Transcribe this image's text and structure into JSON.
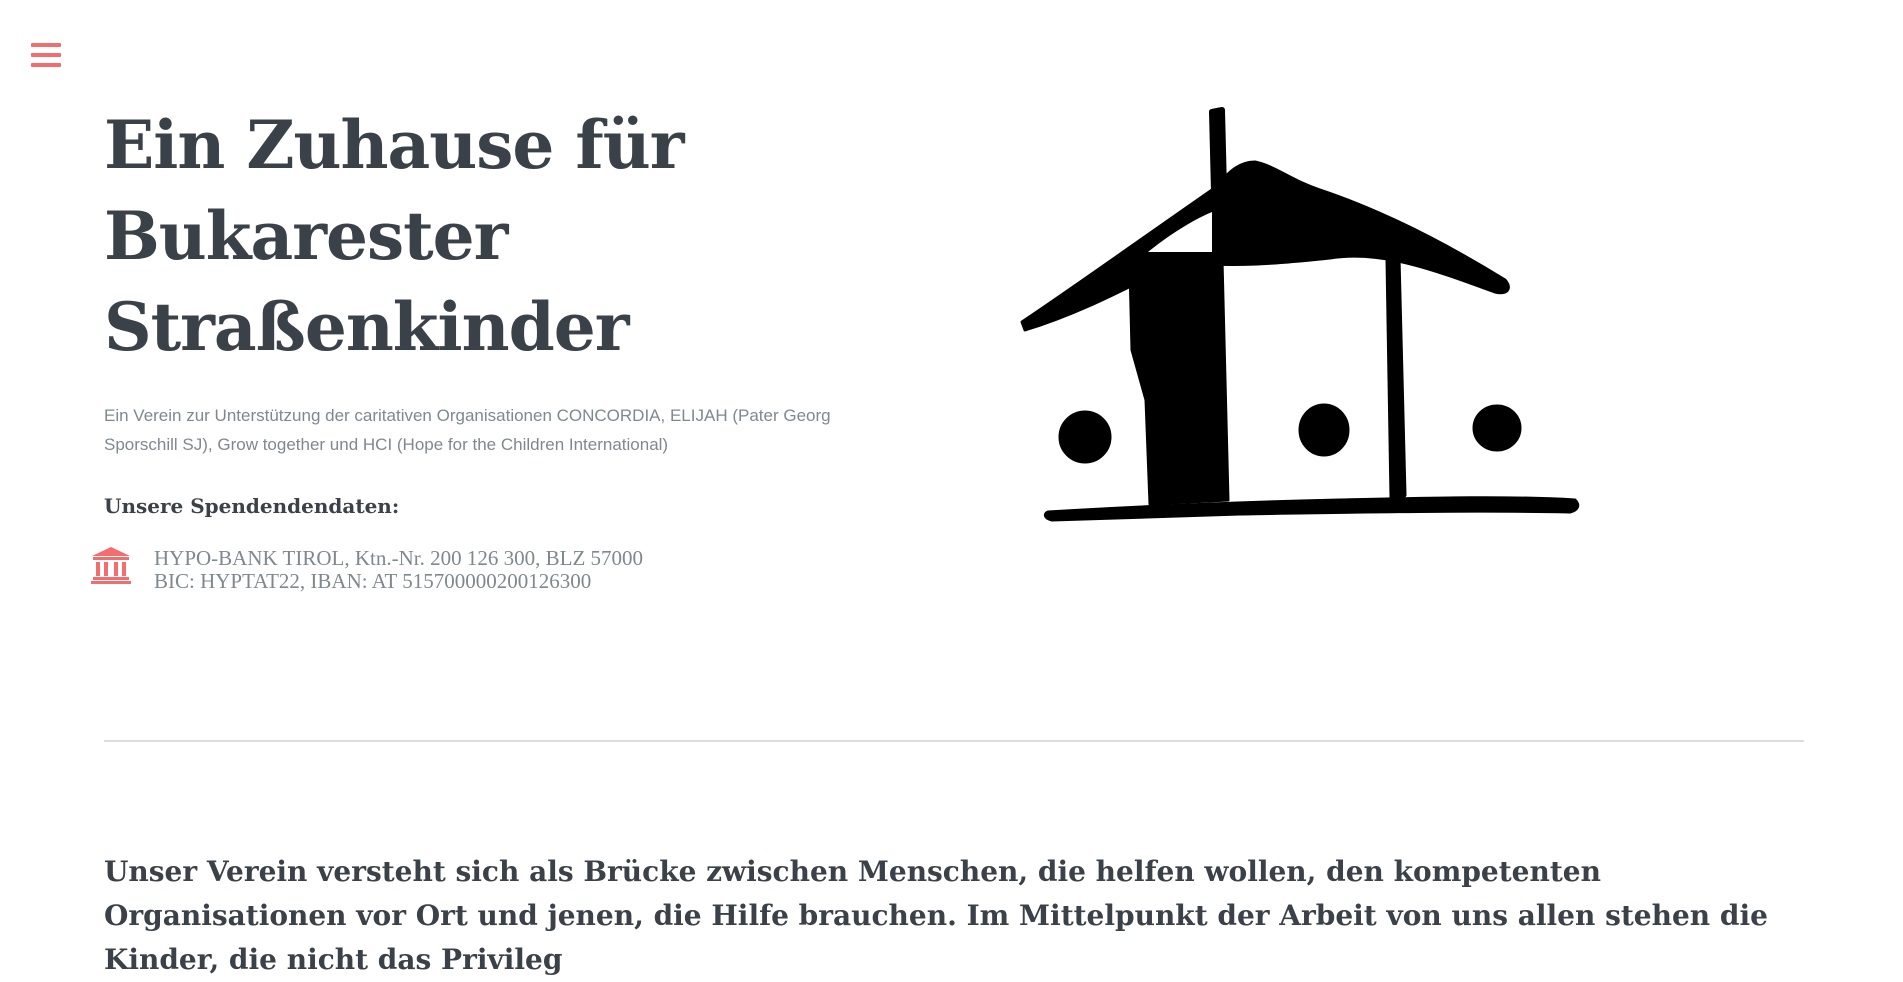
{
  "menu": {
    "icon": "hamburger-menu-icon",
    "color": "#f26d6d"
  },
  "hero": {
    "title_lines": [
      "Ein Zuhause für",
      "Bukarester",
      "Straßenkinder"
    ],
    "subtitle": "Ein Verein zur Unterstützung der caritativen Organisationen CONCORDIA, ELIJAH (Pater Georg Sporschill SJ), Grow together und HCI (Hope for the Children International)"
  },
  "donation": {
    "heading": "Unsere Spendendendaten:",
    "icon": "bank-icon",
    "line1": "HYPO-BANK TIROL, Ktn.-Nr. 200 126 300, BLZ 57000",
    "line2": "BIC: HYPTAT22, IBAN: AT 515700000200126300"
  },
  "logo": {
    "icon": "house-logo"
  },
  "intro": {
    "text": "Unser Verein versteht sich als Brücke zwischen Menschen, die helfen wollen, den kompetenten Organisationen vor Ort und jenen, die Hilfe brauchen. Im Mittelpunkt der Arbeit von uns allen stehen die Kinder, die nicht das Privileg"
  },
  "colors": {
    "accent": "#f26d6d",
    "heading": "#3b4148",
    "muted": "#7f888f",
    "divider": "#dcdcdc"
  }
}
